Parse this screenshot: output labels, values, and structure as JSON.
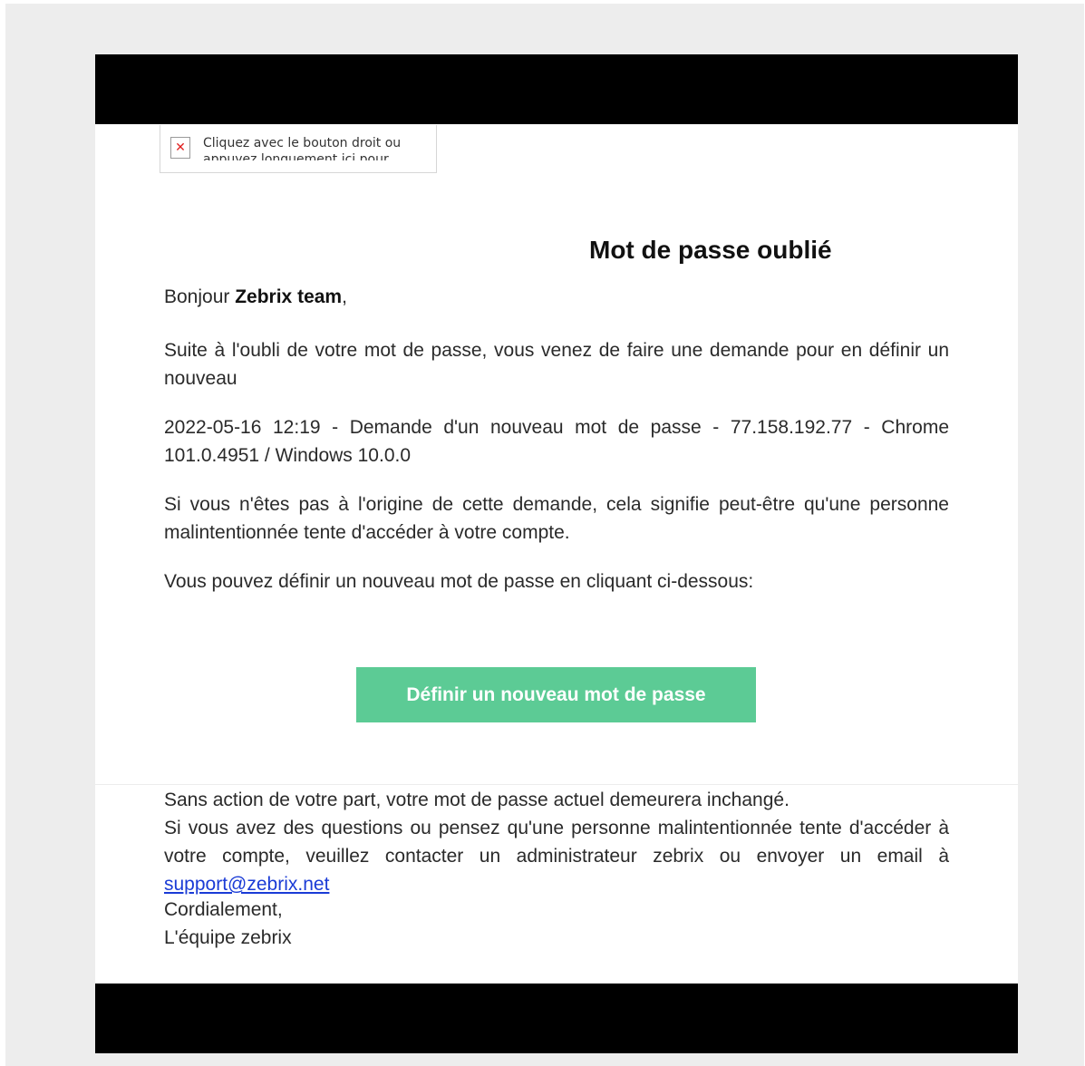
{
  "broken_image": {
    "icon": "broken-image-icon",
    "alt_text": "Cliquez avec le bouton droit ou appuyez longuement ici pour"
  },
  "email": {
    "title": "Mot de passe oublié",
    "greeting_prefix": "Bonjour ",
    "greeting_name": "Zebrix team",
    "greeting_suffix": ",",
    "paragraph_request": "Suite à l'oubli de votre mot de passe, vous venez de faire une demande pour en définir un nouveau",
    "paragraph_log": "2022-05-16 12:19 - Demande d'un nouveau mot de passe - 77.158.192.77 - Chrome 101.0.4951 / Windows 10.0.0",
    "paragraph_warning": "Si vous n'êtes pas à l'origine de cette demande, cela signifie peut-être qu'une personne malintentionnée tente d'accéder à votre compte.",
    "paragraph_cta_intro": "Vous pouvez définir un nouveau mot de passe en cliquant ci-dessous:",
    "cta_label": "Définir un nouveau mot de passe",
    "footer_line1": "Sans action de votre part, votre mot de passe actuel demeurera inchangé.",
    "footer_line2": "Si vous avez des questions ou pensez qu'une personne malintentionnée tente d'accéder à votre compte, veuillez contacter un administrateur zebrix ou envoyer un email à ",
    "support_email": "support@zebrix.net",
    "signoff": "Cordialement,",
    "signature": "L'équipe zebrix"
  },
  "colors": {
    "cta_background": "#5ccb95",
    "header_bar": "#000000",
    "link": "#1a3bd6"
  }
}
